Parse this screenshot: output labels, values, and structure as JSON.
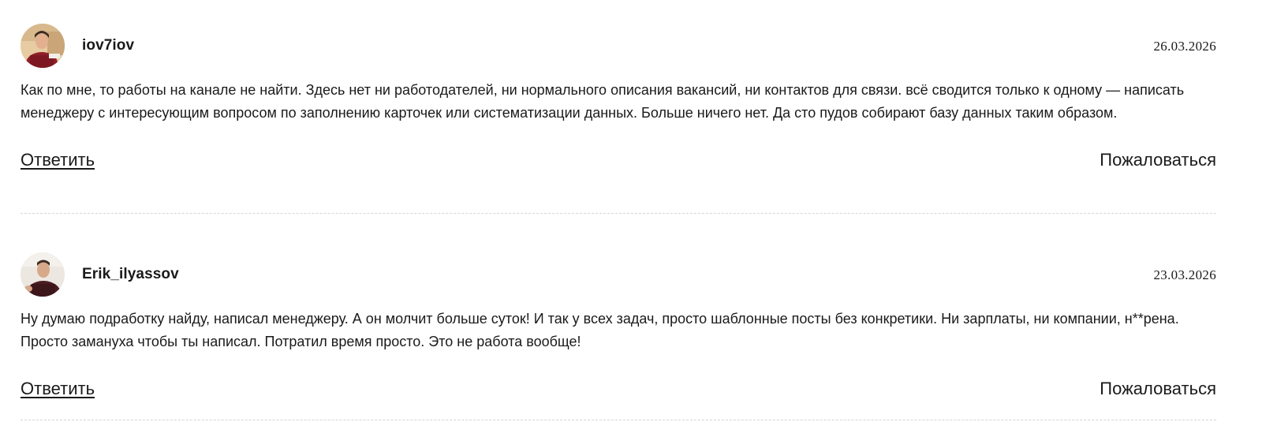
{
  "comments": [
    {
      "username": "iov7iov",
      "date": "26.03.2026",
      "text": "Как по мне, то работы на канале не найти. Здесь нет ни работодателей, ни нормального описания вакансий, ни контактов для связи. всё сводится только к одному — написать менеджеру с интересующим вопросом по заполнению карточек или систематизации данных. Больше ничего нет. Да сто пудов собирают базу данных таким образом.",
      "reply_label": "Ответить",
      "report_label": "Пожаловаться",
      "avatar": "user-photo-red-hoodie"
    },
    {
      "username": "Erik_ilyassov",
      "date": "23.03.2026",
      "text": "Ну думаю подработку найду, написал менеджеру. А он молчит больше суток! И так у всех задач, просто шаблонные посты без конкретики. Ни зарплаты, ни компании, н**рена. Просто замануха чтобы ты написал. Потратил время просто. Это не работа вообще!",
      "reply_label": "Ответить",
      "report_label": "Пожаловаться",
      "avatar": "user-photo-dark-shirt"
    }
  ]
}
